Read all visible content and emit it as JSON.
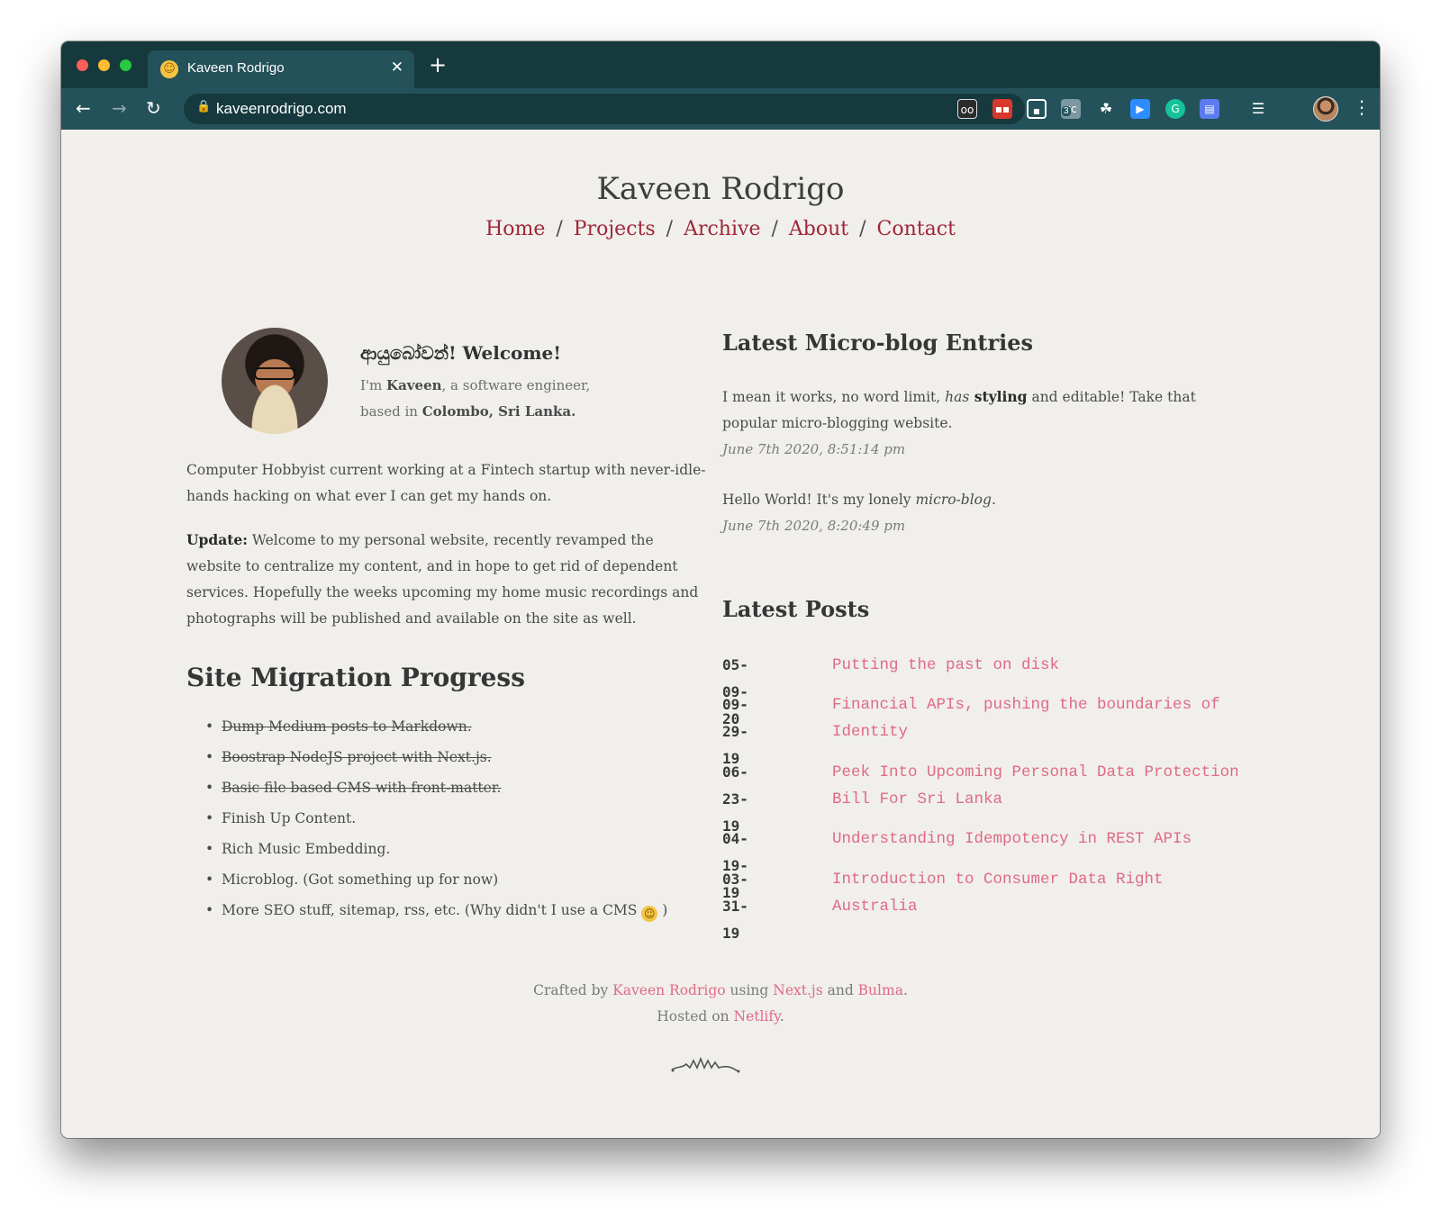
{
  "browser": {
    "tab_title": "Kaveen Rodrigo",
    "tab_close": "✕",
    "new_tab": "+",
    "url": "kaveenrodrigo.com",
    "extension_badge": "3",
    "extensions": [
      "glasses-icon",
      "todoist-icon",
      "picture-in-picture-icon",
      "caption-icon",
      "bug-icon",
      "video-icon",
      "grammarly-icon",
      "save-icon",
      "playlist-icon"
    ]
  },
  "site": {
    "title": "Kaveen Rodrigo",
    "nav": [
      "Home",
      "Projects",
      "Archive",
      "About",
      "Contact"
    ],
    "nav_separator": "/"
  },
  "welcome": {
    "title": "ආයුබෝවන්! Welcome!",
    "im": "I'm ",
    "name": "Kaveen",
    "role": ", a software engineer,",
    "based": "based in ",
    "location": "Colombo, Sri Lanka."
  },
  "intro": "Computer Hobbyist current working at a Fintech startup with never-idle-hands hacking on what ever I can get my hands on.",
  "update": {
    "label": "Update:",
    "text": " Welcome to my personal website, recently revamped the website to centralize my content, and in hope to get rid of dependent services. Hopefully the weeks upcoming my home music recordings and photographs will be published and available on the site as well."
  },
  "migration": {
    "title": "Site Migration Progress",
    "items": [
      {
        "text": "Dump Medium posts to Markdown.",
        "done": true
      },
      {
        "text": "Boostrap NodeJS project with Next.js.",
        "done": true
      },
      {
        "text": "Basic file based CMS with front-matter.",
        "done": true
      },
      {
        "text": "Finish Up Content.",
        "done": false
      },
      {
        "text": "Rich Music Embedding.",
        "done": false
      },
      {
        "text": "Microblog. (Got something up for now)",
        "done": false
      },
      {
        "text": "More SEO stuff, sitemap, rss, etc. (Why didn't I use a CMS ",
        "done": false
      }
    ],
    "last_item_suffix": " )"
  },
  "micro": {
    "title": "Latest Micro-blog Entries",
    "entries": [
      {
        "p1": "I mean it works, no word limit, ",
        "italic": "has",
        "bold": " styling",
        "p2": " and editable! Take that popular micro-blogging website.",
        "date": "June 7th 2020, 8:51:14 pm"
      },
      {
        "p1": "Hello World! It's my lonely ",
        "italic": "micro-blog",
        "p2": ".",
        "date": "June 7th 2020, 8:20:49 pm"
      }
    ]
  },
  "posts": {
    "title": "Latest Posts",
    "items": [
      {
        "date": "05-09-20",
        "title": "Putting the past on disk"
      },
      {
        "date": "09-29-19",
        "title": "Financial APIs, pushing the boundaries of Identity"
      },
      {
        "date": "06-23-19",
        "title": "Peek Into Upcoming Personal Data Protection Bill For Sri Lanka"
      },
      {
        "date": "04-19-19",
        "title": "Understanding Idempotency in REST APIs"
      },
      {
        "date": "03-31-19",
        "title": "Introduction to Consumer Data Right Australia"
      }
    ]
  },
  "footer": {
    "crafted": "Crafted by ",
    "author": "Kaveen Rodrigo",
    "using": " using ",
    "nextjs": "Next.js",
    "and": " and ",
    "bulma": "Bulma",
    "dot": ".",
    "hosted": "Hosted on ",
    "netlify": "Netlify",
    "dot2": "."
  },
  "colors": {
    "tabstrip": "#15393d",
    "toolbar": "#24525a",
    "page_bg": "#f0efec",
    "nav_link": "#a0263a",
    "post_link": "#e06a86"
  }
}
